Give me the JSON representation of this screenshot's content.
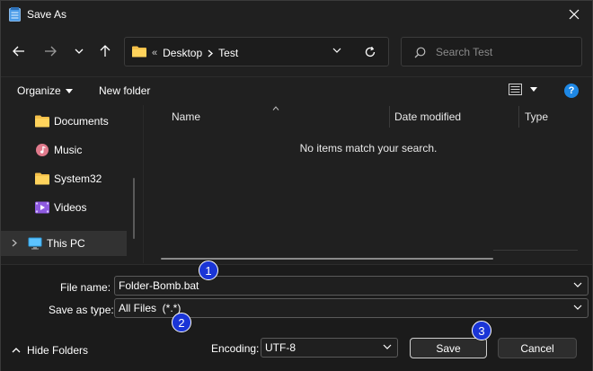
{
  "window": {
    "title": "Save As"
  },
  "address": {
    "overflow": "«",
    "crumbs": [
      "Desktop",
      "Test"
    ]
  },
  "search": {
    "placeholder": "Search Test"
  },
  "toolbar": {
    "organize_label": "Organize",
    "new_folder_label": "New folder"
  },
  "sidebar": {
    "items": [
      {
        "label": "Documents",
        "icon": "documents-folder-icon"
      },
      {
        "label": "Music",
        "icon": "music-icon"
      },
      {
        "label": "System32",
        "icon": "folder-icon"
      },
      {
        "label": "Videos",
        "icon": "videos-icon"
      },
      {
        "label": "This PC",
        "icon": "this-pc-icon"
      }
    ]
  },
  "file_list": {
    "columns": [
      "Name",
      "Date modified",
      "Type"
    ],
    "empty_message": "No items match your search."
  },
  "form": {
    "file_name_label": "File name:",
    "file_name_value": "Folder-Bomb.bat",
    "save_as_type_label": "Save as type:",
    "save_as_type_value": "All Files  (*.*)",
    "encoding_label": "Encoding:",
    "encoding_value": "UTF-8"
  },
  "actions": {
    "hide_folders_label": "Hide Folders",
    "save_label": "Save",
    "cancel_label": "Cancel"
  },
  "markers": [
    "1",
    "2",
    "3"
  ],
  "colors": {
    "background": "#202020",
    "accent_help": "#1e88e5",
    "marker_fill": "#1a35d6"
  }
}
